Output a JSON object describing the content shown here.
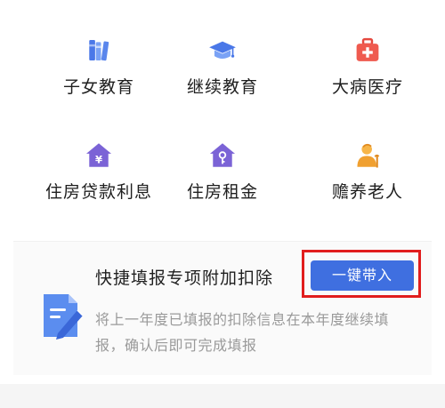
{
  "categories": [
    {
      "label": "子女教育",
      "icon": "books-icon"
    },
    {
      "label": "继续教育",
      "icon": "graduation-cap-icon"
    },
    {
      "label": "大病医疗",
      "icon": "medical-kit-icon"
    },
    {
      "label": "住房贷款利息",
      "icon": "house-yuan-icon"
    },
    {
      "label": "住房租金",
      "icon": "house-key-icon"
    },
    {
      "label": "赡养老人",
      "icon": "elderly-person-icon"
    }
  ],
  "quick_fill": {
    "title": "快捷填报专项附加扣除",
    "button_label": "一键带入",
    "description": "将上一年度已填报的扣除信息在本年度继续填报，确认后即可完成填报",
    "icon": "document-pen-icon"
  },
  "colors": {
    "accent_blue": "#3f6fe0",
    "highlight_red": "#e11d1d",
    "icon_purple": "#7b63d6",
    "icon_red": "#e5483f",
    "icon_orange": "#f0a030"
  }
}
